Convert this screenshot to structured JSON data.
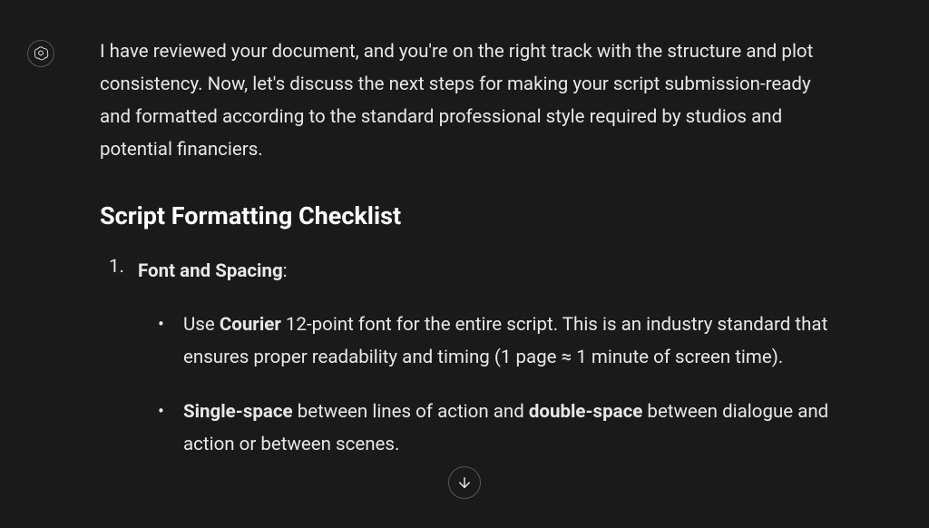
{
  "message": {
    "intro": "I have reviewed your document, and you're on the right track with the structure and plot consistency. Now, let's discuss the next steps for making your script submission-ready and formatted according to the standard professional style required by studios and potential financiers.",
    "heading": "Script Formatting Checklist",
    "items": [
      {
        "title_bold": "Font and Spacing",
        "title_suffix": ":",
        "bullets": [
          {
            "prefix": "Use ",
            "bold1": "Courier",
            "text1": " 12-point font for the entire script. This is an industry standard that ensures proper readability and timing (1 page ≈ 1 minute of screen time)."
          },
          {
            "bold1": "Single-space",
            "text1": " between lines of action and ",
            "bold2": "double-space",
            "text2": " between dialogue and action or between scenes."
          }
        ]
      }
    ]
  }
}
